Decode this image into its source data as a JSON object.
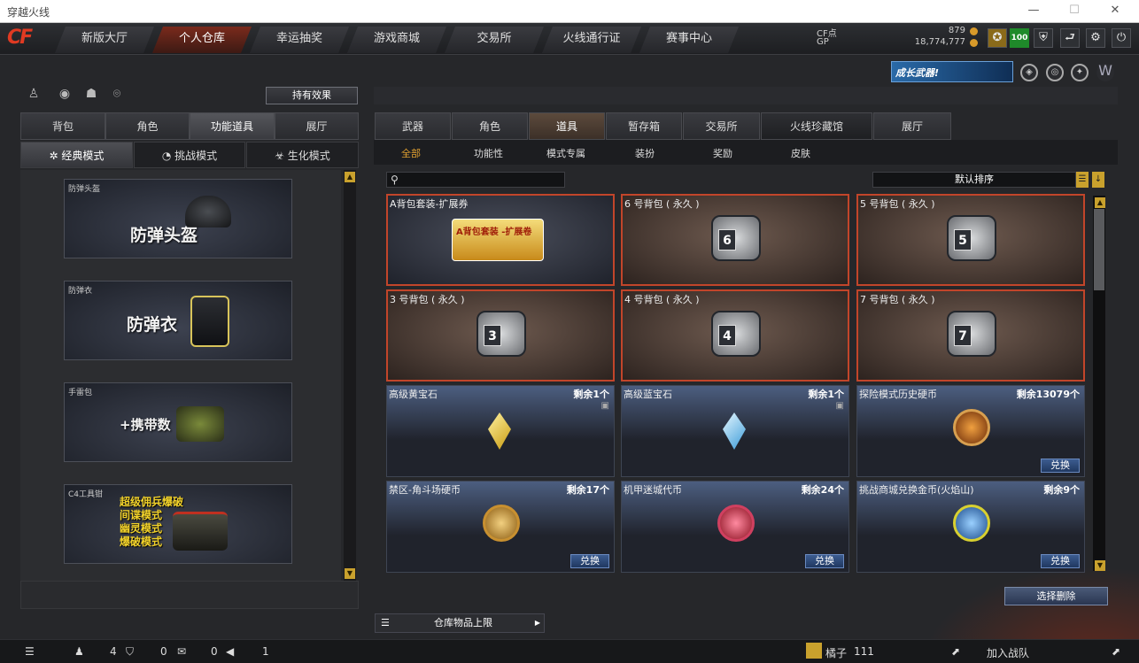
{
  "window": {
    "title": "穿越火线",
    "controls": [
      "—",
      "☐",
      "✕"
    ]
  },
  "nav": {
    "tabs": [
      "新版大厅",
      "个人仓库",
      "幸运抽奖",
      "游戏商城",
      "交易所",
      "火线通行证",
      "赛事中心"
    ],
    "active": 1
  },
  "currency": {
    "cf_label": "CF点",
    "cf_value": "879",
    "gp_label": "GP",
    "gp_value": "18,774,777"
  },
  "player": {
    "level": "100"
  },
  "banner": {
    "text": "成长武器!"
  },
  "left": {
    "effect_button": "持有效果",
    "tabs": [
      "背包",
      "角色",
      "功能道具",
      "展厅"
    ],
    "active_tab": 2,
    "modes": [
      "经典模式",
      "挑战模式",
      "生化模式"
    ],
    "active_mode": 0,
    "cards": [
      {
        "caption": "防弹头盔",
        "title": "防弹头盔"
      },
      {
        "caption": "防弹衣",
        "title": "防弹衣"
      },
      {
        "caption": "手雷包",
        "title": "+携带数"
      },
      {
        "caption": "C4工具钳",
        "title": "超级佣兵爆破",
        "lines": [
          "间谍模式",
          "幽灵模式",
          "爆破模式"
        ]
      }
    ]
  },
  "right": {
    "tabs": [
      "武器",
      "角色",
      "道具",
      "暂存箱",
      "交易所",
      "火线珍藏馆",
      "展厅"
    ],
    "active_tab": 2,
    "subtabs": [
      "全部",
      "功能性",
      "模式专属",
      "装扮",
      "奖励",
      "皮肤"
    ],
    "active_subtab": 0,
    "search_placeholder": "",
    "sort_label": "默认排序",
    "items": [
      {
        "name": "A背包套装-扩展券",
        "kind": "ticket",
        "art_text": "A背包套装 -扩展卷",
        "style": "blue"
      },
      {
        "name": "6 号背包 ( 永久 )",
        "kind": "bag",
        "bag": "6",
        "style": "orange"
      },
      {
        "name": "5 号背包 ( 永久 )",
        "kind": "bag",
        "bag": "5",
        "style": "orange"
      },
      {
        "name": "3 号背包 ( 永久 )",
        "kind": "bag",
        "bag": "3",
        "style": "orange"
      },
      {
        "name": "4 号背包 ( 永久 )",
        "kind": "bag",
        "bag": "4",
        "style": "orange"
      },
      {
        "name": "7 号背包 ( 永久 )",
        "kind": "bag",
        "bag": "7",
        "style": "orange"
      },
      {
        "name": "高级黄宝石",
        "kind": "gem",
        "remain": "剩余1个",
        "gem_color": "#e4b52a",
        "style": "blue"
      },
      {
        "name": "高级蓝宝石",
        "kind": "gem",
        "remain": "剩余1个",
        "gem_color": "#7ac8f0",
        "style": "blue"
      },
      {
        "name": "探险模式历史硬币",
        "kind": "coin",
        "remain": "剩余13079个",
        "coin_color": "#c0501a",
        "exchange": "兑换",
        "style": "blue"
      },
      {
        "name": "禁区-角斗场硬币",
        "kind": "coin",
        "remain": "剩余17个",
        "coin_color": "#c8902a",
        "exchange": "兑换",
        "style": "blue"
      },
      {
        "name": "机甲迷城代币",
        "kind": "coin",
        "remain": "剩余24个",
        "coin_color": "#d0304a",
        "exchange": "兑换",
        "style": "blue"
      },
      {
        "name": "挑战商城兑换金币(火焰山)",
        "kind": "coin",
        "remain": "剩余9个",
        "coin_color": "#3a8ad0",
        "exchange": "兑换",
        "style": "blue"
      }
    ],
    "delete_button": "选择删除",
    "storage_label": "仓库物品上限"
  },
  "status": {
    "friends": "4",
    "guard": "0",
    "chat": "0",
    "volume": "1",
    "name": "橘子",
    "num": "111",
    "clan_text": "加入战队"
  },
  "colors": {
    "accent": "#c2452a",
    "gold": "#c9a12d"
  }
}
